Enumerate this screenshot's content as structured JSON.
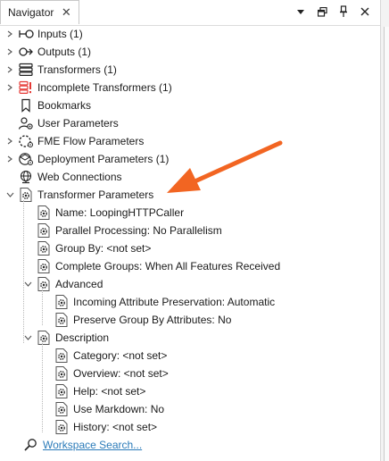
{
  "panel": {
    "tab_label": "Navigator",
    "close_glyph": "✕"
  },
  "title_buttons": [
    "chevron-down-icon",
    "float-window-icon",
    "pin-icon",
    "close-icon"
  ],
  "tree": {
    "inputs": "Inputs (1)",
    "outputs": "Outputs (1)",
    "transformers": "Transformers (1)",
    "incomplete_transformers": "Incomplete Transformers (1)",
    "bookmarks": "Bookmarks",
    "user_parameters": "User Parameters",
    "fme_flow_parameters": "FME Flow Parameters",
    "deployment_parameters": "Deployment Parameters (1)",
    "web_connections": "Web Connections",
    "transformer_parameters": "Transformer Parameters",
    "tp_name": "Name: LoopingHTTPCaller",
    "tp_parallel": "Parallel Processing: No Parallelism",
    "tp_group_by": "Group By: <not set>",
    "tp_complete_groups": "Complete Groups: When All Features Received",
    "advanced": "Advanced",
    "adv_incoming": "Incoming Attribute Preservation: Automatic",
    "adv_preserve": "Preserve Group By Attributes: No",
    "description": "Description",
    "desc_category": "Category: <not set>",
    "desc_overview": "Overview: <not set>",
    "desc_help": "Help: <not set>",
    "desc_markdown": "Use Markdown: No",
    "desc_history": "History: <not set>",
    "workspace_search": "Workspace Search..."
  },
  "colors": {
    "annotation_arrow": "#f26522",
    "link": "#2b7bb9",
    "error_icon": "#e53935"
  }
}
